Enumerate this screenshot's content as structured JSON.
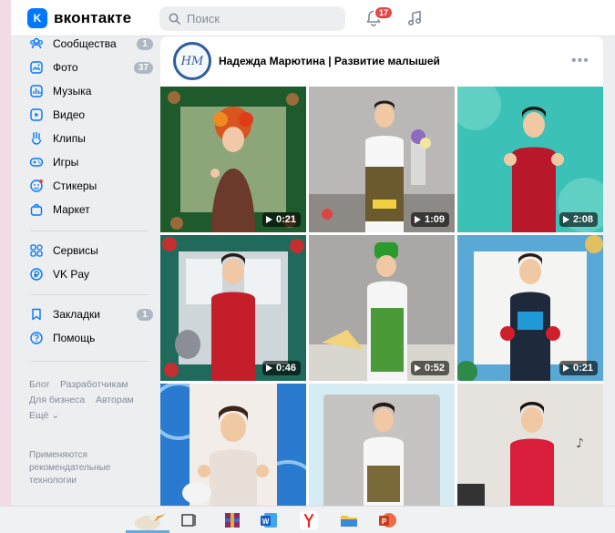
{
  "header": {
    "logo_letter": "K",
    "logo_text": "вконтакте",
    "search_placeholder": "Поиск",
    "notifications_count": "17"
  },
  "sidebar": {
    "items": [
      {
        "label": "Сообщества",
        "count": "1"
      },
      {
        "label": "Фото",
        "count": "37"
      },
      {
        "label": "Музыка",
        "count": ""
      },
      {
        "label": "Видео",
        "count": ""
      },
      {
        "label": "Клипы",
        "count": ""
      },
      {
        "label": "Игры",
        "count": ""
      },
      {
        "label": "Стикеры",
        "count": ""
      },
      {
        "label": "Маркет",
        "count": ""
      },
      {
        "label": "Сервисы",
        "count": ""
      },
      {
        "label": "VK Pay",
        "count": ""
      },
      {
        "label": "Закладки",
        "count": "1"
      },
      {
        "label": "Помощь",
        "count": ""
      }
    ],
    "footer_links": [
      "Блог",
      "Разработчикам",
      "Для бизнеса",
      "Авторам",
      "Ещё"
    ],
    "footer_note": "Применяются рекомендательные технологии"
  },
  "group": {
    "name": "Надежда Марютина | Развитие малышей",
    "avatar_text": "НМ"
  },
  "clips": [
    {
      "duration": "0:21",
      "theme": "autumn wreath"
    },
    {
      "duration": "1:09",
      "theme": "apron & flowers"
    },
    {
      "duration": "2:08",
      "theme": "teal background"
    },
    {
      "duration": "0:46",
      "theme": "winter frame"
    },
    {
      "duration": "0:52",
      "theme": "green hat"
    },
    {
      "duration": "0:21",
      "theme": "sea frame"
    },
    {
      "duration": "",
      "theme": "blue swirls"
    },
    {
      "duration": "",
      "theme": "white frame"
    },
    {
      "duration": "",
      "theme": "red dress"
    }
  ],
  "colors": {
    "accent": "#0077ff",
    "badge_red": "#e64646",
    "counter_gray": "#aeb7c2"
  }
}
